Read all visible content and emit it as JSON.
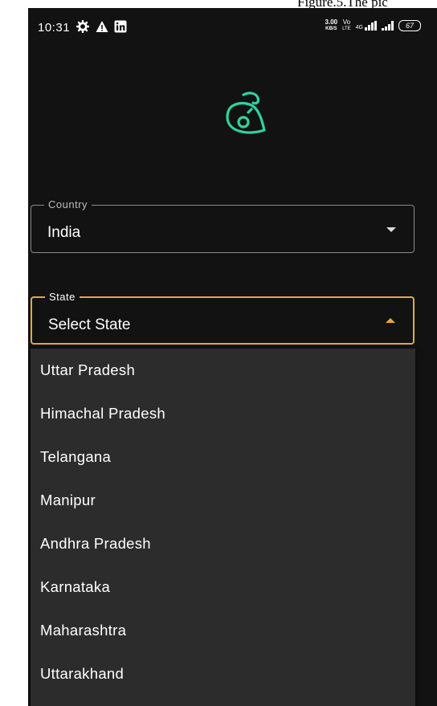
{
  "caption": "Figure.5.The pic",
  "status_bar": {
    "time": "10:31",
    "speed_value": "3.00",
    "speed_unit": "KB/S",
    "volte_top": "Vo",
    "volte_bottom": "LTE",
    "network": "4G",
    "battery": "67",
    "left_icons": [
      "gear-icon",
      "warning-icon",
      "linkedin-icon"
    ]
  },
  "country": {
    "label": "Country",
    "value": "India"
  },
  "state": {
    "label": "State",
    "value": "Select State",
    "options": [
      "Uttar Pradesh",
      "Himachal Pradesh",
      "Telangana",
      "Manipur",
      "Andhra Pradesh",
      "Karnataka",
      "Maharashtra",
      "Uttarakhand"
    ]
  },
  "colors": {
    "background": "#121212",
    "accent": "#e7a93d",
    "logo": "#2ed3a0",
    "dropdown": "#2c2c2c"
  }
}
